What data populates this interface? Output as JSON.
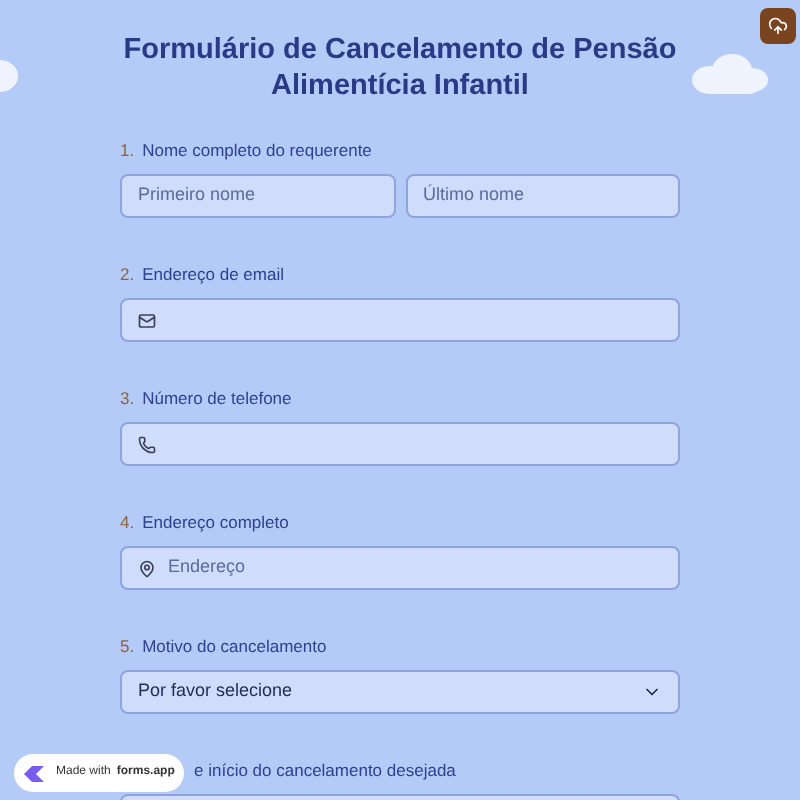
{
  "title": "Formulário de Cancelamento de Pensão Alimentícia Infantil",
  "questions": [
    {
      "number": "1.",
      "label": "Nome completo do requerente",
      "kind": "name",
      "placeholders": [
        "Primeiro nome",
        "Último nome"
      ]
    },
    {
      "number": "2.",
      "label": "Endereço de email",
      "kind": "email"
    },
    {
      "number": "3.",
      "label": "Número de telefone",
      "kind": "phone"
    },
    {
      "number": "4.",
      "label": "Endereço completo",
      "kind": "address",
      "placeholder": "Endereço"
    },
    {
      "number": "5.",
      "label": "Motivo do cancelamento",
      "kind": "select",
      "value": "Por favor selecione"
    },
    {
      "label": "e início do cancelamento desejada",
      "kind": "plain"
    }
  ],
  "badge": {
    "prefix": "Made with",
    "brand": "forms.app"
  }
}
